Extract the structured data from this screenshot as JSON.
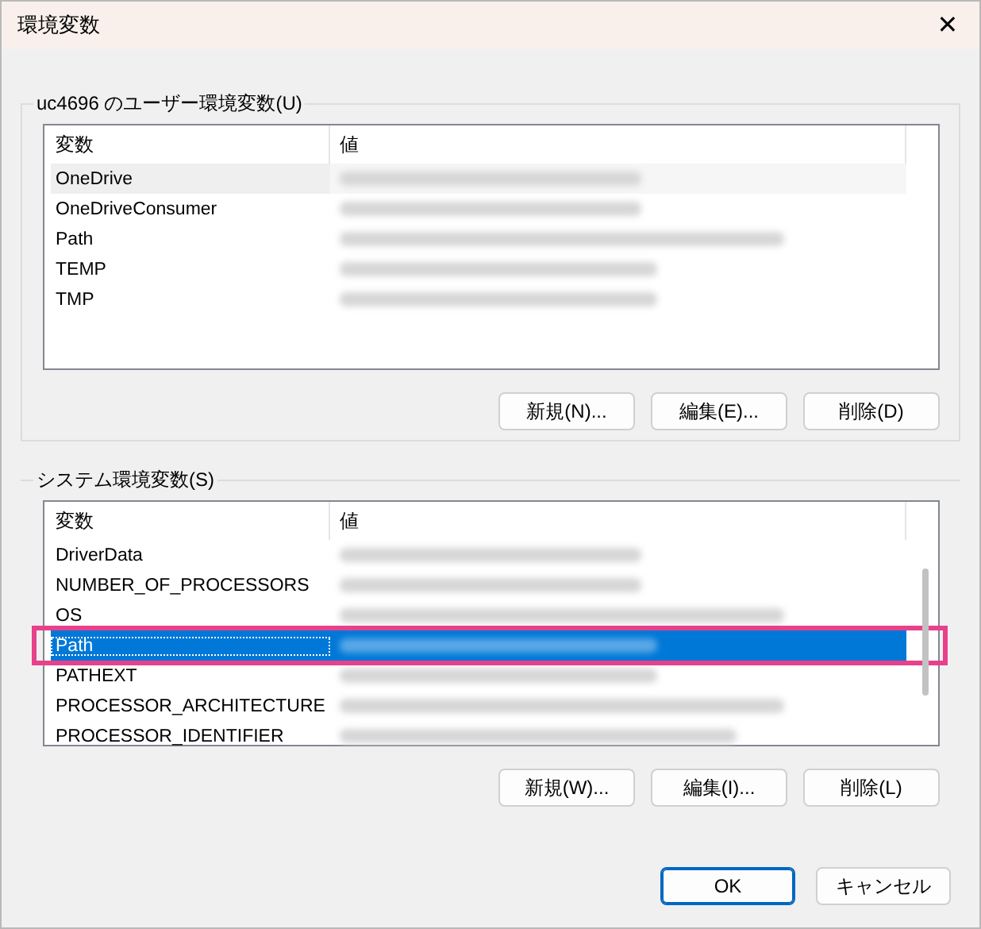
{
  "window": {
    "title": "環境変数",
    "close": "✕"
  },
  "user_group": {
    "label": "uc4696 のユーザー環境変数(U)",
    "columns": [
      "変数",
      "値"
    ],
    "rows": [
      {
        "name": "OneDrive",
        "selected": false,
        "hovered": true,
        "annotated": false
      },
      {
        "name": "OneDriveConsumer",
        "selected": false,
        "hovered": false,
        "annotated": false
      },
      {
        "name": "Path",
        "selected": false,
        "hovered": false,
        "annotated": false
      },
      {
        "name": "TEMP",
        "selected": false,
        "hovered": false,
        "annotated": false
      },
      {
        "name": "TMP",
        "selected": false,
        "hovered": false,
        "annotated": false
      }
    ],
    "buttons": [
      "新規(N)...",
      "編集(E)...",
      "削除(D)"
    ]
  },
  "system_group": {
    "label": "システム環境変数(S)",
    "columns": [
      "変数",
      "値"
    ],
    "rows": [
      {
        "name": "DriverData",
        "selected": false,
        "hovered": false,
        "annotated": false
      },
      {
        "name": "NUMBER_OF_PROCESSORS",
        "selected": false,
        "hovered": false,
        "annotated": false
      },
      {
        "name": "OS",
        "selected": false,
        "hovered": false,
        "annotated": false
      },
      {
        "name": "Path",
        "selected": true,
        "hovered": false,
        "annotated": true
      },
      {
        "name": "PATHEXT",
        "selected": false,
        "hovered": false,
        "annotated": false
      },
      {
        "name": "PROCESSOR_ARCHITECTURE",
        "selected": false,
        "hovered": false,
        "annotated": false
      },
      {
        "name": "PROCESSOR_IDENTIFIER",
        "selected": false,
        "hovered": false,
        "annotated": false
      }
    ],
    "buttons": [
      "新規(W)...",
      "編集(I)...",
      "削除(L)"
    ]
  },
  "footer_buttons": [
    {
      "label": "OK",
      "kind": "default"
    },
    {
      "label": "キャンセル",
      "kind": "normal"
    }
  ]
}
